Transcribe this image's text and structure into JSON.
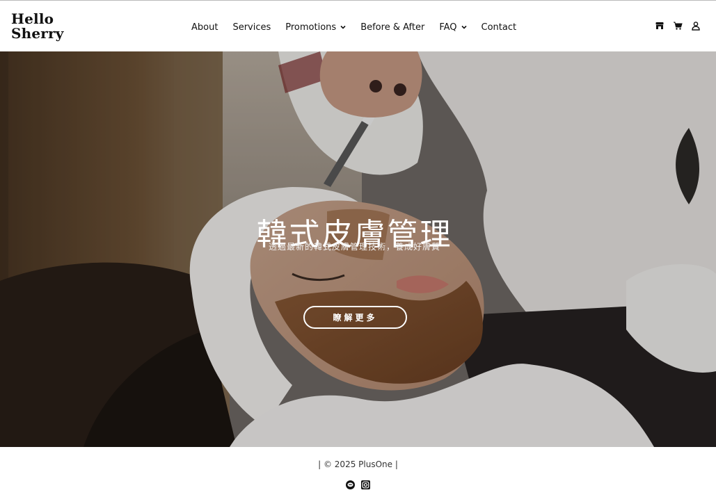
{
  "brand": {
    "line1": "Hello",
    "line2": "Sherry"
  },
  "nav": {
    "items": [
      {
        "label": "About"
      },
      {
        "label": "Services"
      },
      {
        "label": "Promotions"
      },
      {
        "label": "Before & After"
      },
      {
        "label": "FAQ"
      },
      {
        "label": "Contact"
      }
    ]
  },
  "header_icons": [
    "store-icon",
    "cart-icon",
    "user-icon"
  ],
  "hero": {
    "title": "韓式皮膚管理",
    "subtitle": "透過最新的韓式皮膚管理技術，養成好膚質",
    "button_label": "瞭解更多"
  },
  "footer": {
    "copyright": "| © 2025 PlusOne |",
    "social_icons": [
      "line-icon",
      "instagram-icon"
    ]
  },
  "colors": {
    "text": "#111111",
    "hero_text": "#ffffff",
    "background": "#ffffff"
  }
}
